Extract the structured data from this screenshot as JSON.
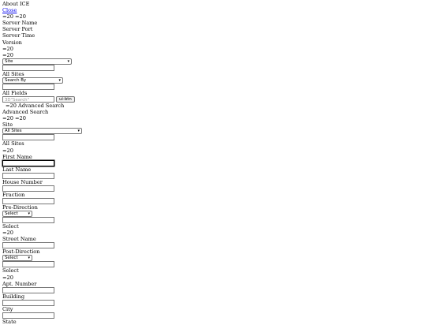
{
  "about": {
    "title": "About ICE",
    "close_label": "Close",
    "eq_row": "=20 =20",
    "fields": [
      "Server Name",
      "Server Port",
      "Server Time",
      "Version"
    ],
    "eq1": "=20",
    "eq2": "=20"
  },
  "quick_search": {
    "site_select": "Site",
    "site_value": "All Sites",
    "search_by_select": "Search By",
    "search_by_value": "All Fields",
    "search_placeholder": "3D\"Search\"",
    "ui_btn_label": "ui-btn",
    "advanced_link": "=20 Advanced Search"
  },
  "advanced": {
    "heading": "Advanced Search",
    "eq_row": "=20 =20",
    "site_label": "Site",
    "site_select": "All Sites",
    "site_value": "All Sites",
    "eq_after_site": "=20",
    "first_name": "First Name",
    "last_name": "Last Name",
    "house_number": "House Number",
    "fraction": "Fraction",
    "pre_direction": "Pre-Direction",
    "pre_direction_select": "Select",
    "pre_direction_value": "Select",
    "eq_after_pre": "=20",
    "street_name": "Street Name",
    "post_direction": "Post-Direction",
    "post_direction_select": "Select",
    "post_direction_value": "Select",
    "eq_after_post": "=20",
    "apt_number": "Apt. Number",
    "building": "Building",
    "city": "City",
    "state": "State"
  }
}
